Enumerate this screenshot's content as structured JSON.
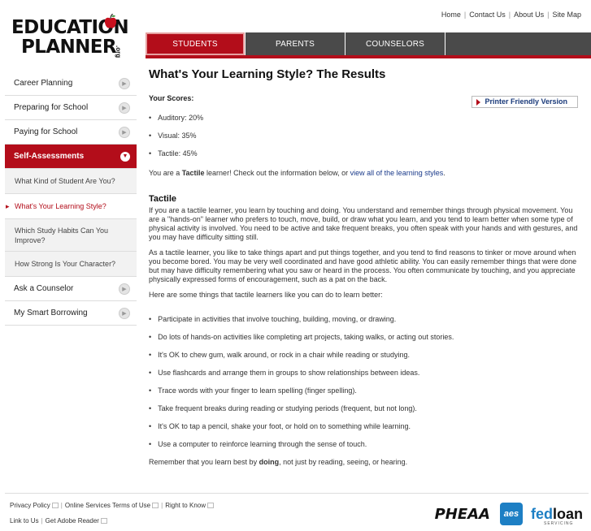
{
  "logo": {
    "line1": "EDUCATION",
    "line2": "PLANNER",
    "suffix": ".org"
  },
  "top_links": [
    "Home",
    "Contact Us",
    "About Us",
    "Site Map"
  ],
  "tabs": [
    "STUDENTS",
    "PARENTS",
    "COUNSELORS"
  ],
  "active_tab": "STUDENTS",
  "sidebar": {
    "items": [
      {
        "label": "Career Planning"
      },
      {
        "label": "Preparing for School"
      },
      {
        "label": "Paying for School"
      },
      {
        "label": "Self-Assessments"
      },
      {
        "label": "Ask a Counselor"
      },
      {
        "label": "My Smart Borrowing"
      }
    ],
    "sub_items": [
      {
        "label": "What Kind of Student Are You?"
      },
      {
        "label": "What's Your Learning Style?"
      },
      {
        "label": "Which Study Habits Can You Improve?"
      },
      {
        "label": "How Strong Is Your Character?"
      }
    ]
  },
  "main": {
    "title": "What's Your Learning Style? The Results",
    "scores_title": "Your Scores:",
    "printer_friendly": "Printer Friendly Version",
    "scores": [
      "Auditory: 20%",
      "Visual: 35%",
      "Tactile: 45%"
    ],
    "you_are": {
      "pre": "You are a ",
      "style": "Tactile",
      "mid": " learner! Check out the information below, or ",
      "link": "view all of the learning styles",
      "post": "."
    },
    "section_title": "Tactile",
    "para1": "If you are a tactile learner, you learn by touching and doing. You understand and remember things through physical movement. You are a \"hands-on\" learner who prefers to touch, move, build, or draw what you learn, and you tend to learn better when some type of physical activity is involved. You need to be active and take frequent breaks, you often speak with your hands and with gestures, and you may have difficulty sitting still.",
    "para2": "As a tactile learner, you like to take things apart and put things together, and you tend to find reasons to tinker or move around when you become bored. You may be very well coordinated and have good athletic ability. You can easily remember things that were done but may have difficulty remembering what you saw or heard in the process. You often communicate by touching, and you appreciate physically expressed forms of encouragement, such as a pat on the back.",
    "intro": "Here are some things that tactile learners like you can do to learn better:",
    "tips": [
      "Participate in activities that involve touching, building, moving, or drawing.",
      "Do lots of hands-on activities like completing art projects, taking walks, or acting out stories.",
      "It's OK to chew gum, walk around, or rock in a chair while reading or studying.",
      "Use flashcards and arrange them in groups to show relationships between ideas.",
      "Trace words with your finger to learn spelling (finger spelling).",
      "Take frequent breaks during reading or studying periods (frequent, but not long).",
      "It's OK to tap a pencil, shake your foot, or hold on to something while learning.",
      "Use a computer to reinforce learning through the sense of touch."
    ],
    "closing": {
      "pre": "Remember that you learn best by ",
      "bold": "doing",
      "post": ", not just by reading, seeing, or hearing."
    }
  },
  "footer": {
    "row1": [
      "Privacy Policy",
      "Online Services Terms of Use",
      "Right to Know"
    ],
    "row2": [
      "Link to Us",
      "Get Adobe Reader"
    ],
    "logos": {
      "pheaa": "PHEAA",
      "aes": "aes",
      "fedloan_a": "fed",
      "fedloan_b": "loan",
      "fedloan_servicing": "SERVICING"
    }
  },
  "colors": {
    "brand_red": "#b30d1a",
    "tab_gray": "#4a4a4a",
    "link_blue": "#1a3a8a",
    "aes_blue": "#1d7fc4"
  }
}
